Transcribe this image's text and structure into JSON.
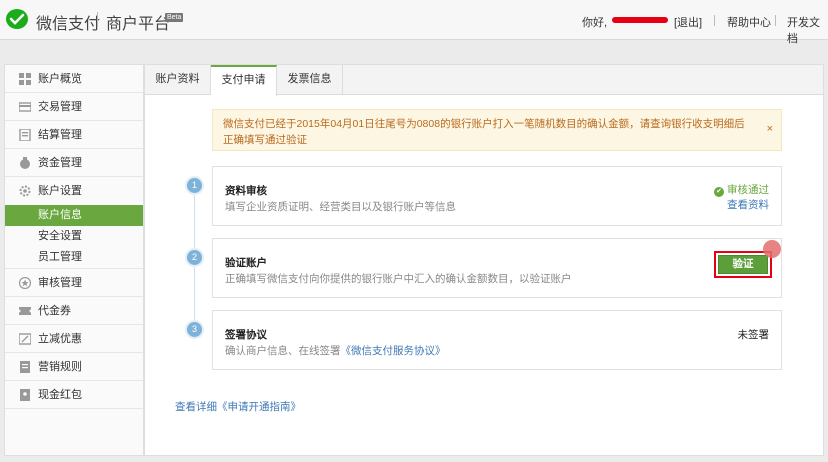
{
  "header": {
    "logo_text": "微信支付",
    "platform_text": "商户平台",
    "beta_badge": "Beta",
    "greeting": "你好,",
    "logout_label": "[退出]",
    "help_label": "帮助中心",
    "dev_doc_label": "开发文档"
  },
  "sidebar": {
    "items": [
      {
        "label": "账户概览",
        "icon": "grid-icon"
      },
      {
        "label": "交易管理",
        "icon": "card-icon"
      },
      {
        "label": "结算管理",
        "icon": "document-icon"
      },
      {
        "label": "资金管理",
        "icon": "money-bag-icon"
      },
      {
        "label": "账户设置",
        "icon": "gear-icon"
      },
      {
        "label": "审核管理",
        "icon": "star-icon"
      },
      {
        "label": "代金券",
        "icon": "voucher-icon"
      },
      {
        "label": "立减优惠",
        "icon": "discount-icon"
      },
      {
        "label": "营销规则",
        "icon": "rules-icon"
      },
      {
        "label": "现金红包",
        "icon": "red-packet-icon"
      }
    ],
    "sub_items": [
      {
        "label": "账户信息",
        "active": true
      },
      {
        "label": "安全设置",
        "active": false
      },
      {
        "label": "员工管理",
        "active": false
      }
    ]
  },
  "tabs": [
    {
      "label": "账户资料",
      "active": false
    },
    {
      "label": "支付申请",
      "active": true
    },
    {
      "label": "发票信息",
      "active": false
    }
  ],
  "notice": {
    "text": "微信支付已经于2015年04月01日往尾号为0808的银行账户打入一笔随机数目的确认金额，请查询银行收支明细后正确填写通过验证",
    "close": "×"
  },
  "steps": [
    {
      "num": "1",
      "title": "资料审核",
      "desc": "填写企业资质证明、经营类目以及银行账户等信息",
      "status": "审核通过",
      "link": "查看资料"
    },
    {
      "num": "2",
      "title": "验证账户",
      "desc": "正确填写微信支付向你提供的银行账户中汇入的确认金额数目，以验证账户",
      "button": "验证"
    },
    {
      "num": "3",
      "title": "签署协议",
      "desc_prefix": "确认商户信息、在线签署",
      "desc_link": "《微信支付服务协议》",
      "status": "未签署"
    }
  ],
  "guide_link": "查看详细《申请开通指南》",
  "colors": {
    "accent_green": "#6aa73f",
    "link_blue": "#3f78b5",
    "highlight_red": "#e60012",
    "notice_text": "#b96b1f"
  }
}
